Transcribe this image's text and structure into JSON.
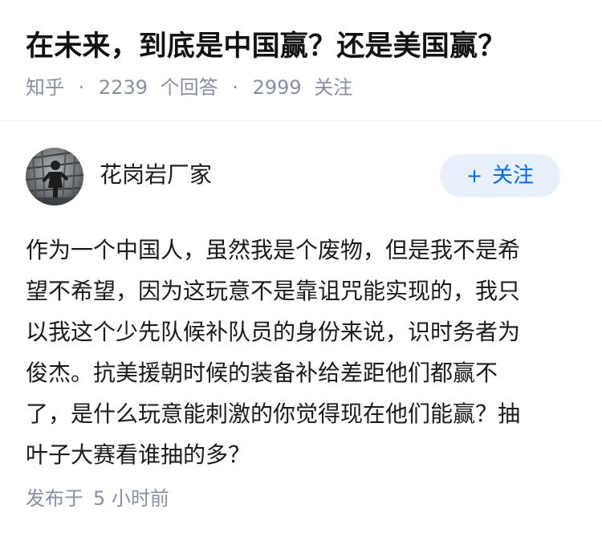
{
  "question": {
    "title": "在未来，到底是中国赢？还是美国赢？",
    "source": "知乎",
    "separator": "·",
    "answer_count": "2239",
    "answer_count_label": "个回答",
    "follower_count": "2999",
    "follower_count_label": "关注"
  },
  "author": {
    "name": "花岗岩厂家",
    "avatar_icon": "person-photo-avatar"
  },
  "follow_button": {
    "icon": "plus-icon",
    "icon_glyph": "+",
    "label": "关注",
    "background": "#e8f0fb",
    "color": "#0066ff"
  },
  "answer": {
    "lines": [
      "作为一个中国人，虽然我是个废物，但是我不是希",
      "望不希望，因为这玩意不是靠诅咒能实现的，我只",
      "以我这个少先队候补队员的身份来说，识时务者为",
      "俊杰。抗美援朝时候的装备补给差距他们都赢不",
      "了，是什么玩意能刺激的你觉得现在他们能赢？抽",
      "叶子大赛看谁抽的多？"
    ],
    "published_label": "发布于",
    "published_time": "5 小时前"
  },
  "colors": {
    "title": "#121212",
    "meta": "#8590a6",
    "body": "#1a1a1a",
    "divider": "#f0f2f7"
  }
}
